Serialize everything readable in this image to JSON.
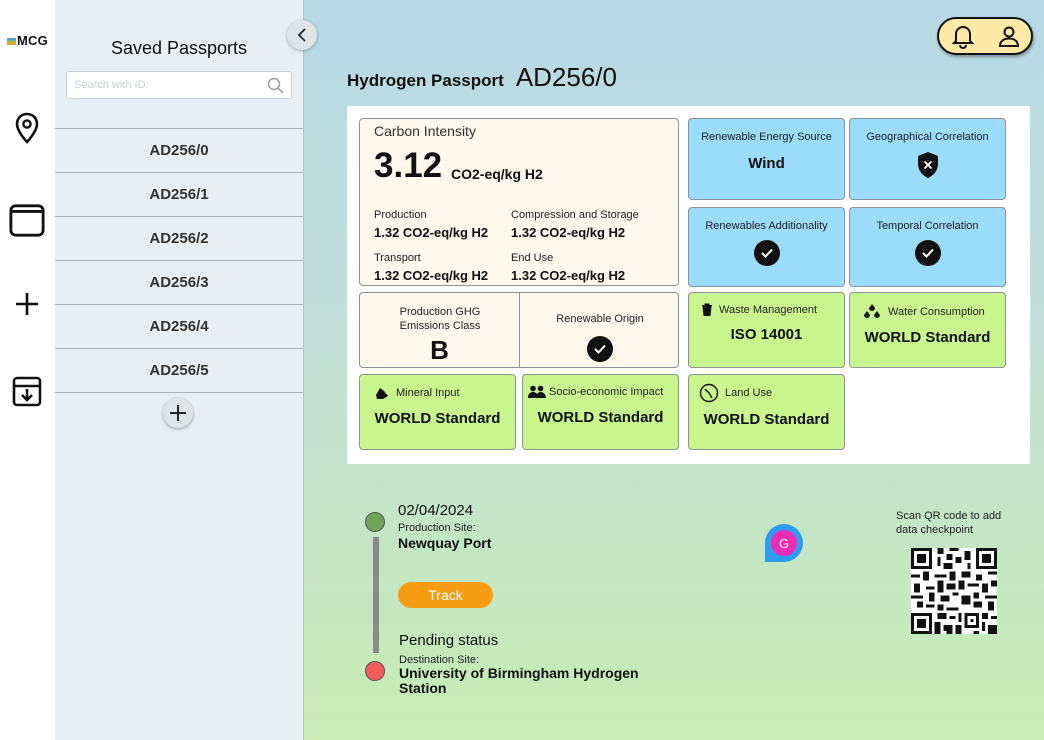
{
  "brand": {
    "name": "MCG"
  },
  "sidebar": {
    "title": "Saved Passports",
    "search_placeholder": "Search with ID:",
    "items": [
      "AD256/0",
      "AD256/1",
      "AD256/2",
      "AD256/3",
      "AD256/4",
      "AD256/5"
    ]
  },
  "passport": {
    "label": "Hydrogen Passport",
    "id": "AD256/0",
    "carbon": {
      "title": "Carbon Intensity",
      "value": "3.12",
      "unit": "CO2-eq/kg H2",
      "production_label": "Production",
      "production_value": "1.32 CO2-eq/kg H2",
      "compression_label": "Compression and Storage",
      "compression_value": "1.32 CO2-eq/kg H2",
      "transport_label": "Transport",
      "transport_value": "1.32 CO2-eq/kg H2",
      "enduse_label": "End Use",
      "enduse_value": "1.32 CO2-eq/kg H2"
    },
    "ghg": {
      "title": "Production GHG Emissions Class",
      "value": "B"
    },
    "renewable_origin": {
      "title": "Renewable Origin"
    },
    "renewable_source": {
      "title": "Renewable Energy Source",
      "value": "Wind"
    },
    "geo": {
      "title": "Geographical Correlation"
    },
    "additionality": {
      "title": "Renewables Additionality"
    },
    "temporal": {
      "title": "Temporal Correlation"
    },
    "waste": {
      "title": "Waste Management",
      "value": "ISO 14001"
    },
    "water": {
      "title": "Water Consumption",
      "value": "WORLD Standard"
    },
    "mineral": {
      "title": "Mineral Input",
      "value": "WORLD Standard"
    },
    "socio": {
      "title": "Socio-economic Impact",
      "value": "WORLD Standard"
    },
    "land": {
      "title": "Land Use",
      "value": "WORLD Standard"
    }
  },
  "timeline": {
    "date": "02/04/2024",
    "production_label": "Production Site:",
    "production_site": "Newquay Port",
    "track_label": "Track",
    "pending": "Pending status",
    "destination_label": "Destination Site:",
    "destination_site": "University of Birmingham Hydrogen Station"
  },
  "qr": {
    "caption": "Scan QR code to add data checkpoint"
  },
  "fab": {
    "letter": "G"
  },
  "colors": {
    "accent_orange": "#f79d13",
    "card_blue": "#9bdcfb",
    "card_green": "#c9f58f",
    "card_cream": "#fdf7ec"
  }
}
